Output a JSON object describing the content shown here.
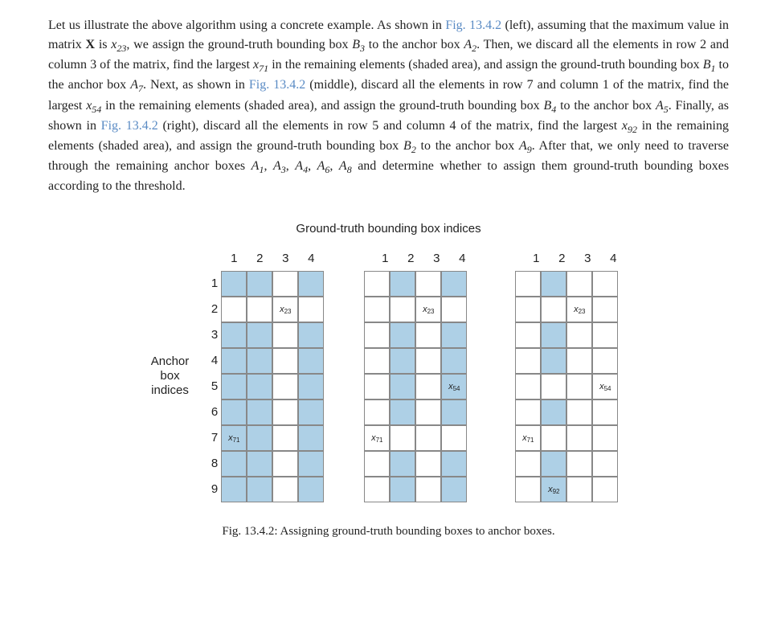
{
  "paragraph": {
    "p1": "Let us illustrate the above algorithm using a concrete example. As shown in ",
    "figref1": "Fig. 13.4.2",
    "p2": " (left), assuming that the maximum value in matrix ",
    "X": "X",
    "p3": " is ",
    "x23": "x",
    "x23sub": "23",
    "p4": ", we assign the ground-truth bounding box ",
    "B3": "B",
    "B3sub": "3",
    "p5": " to the anchor box ",
    "A2": "A",
    "A2sub": "2",
    "p6": ". Then, we discard all the elements in row 2 and column 3 of the matrix, find the largest ",
    "x71": "x",
    "x71sub": "71",
    "p7": " in the remaining elements (shaded area), and assign the ground-truth bounding box ",
    "B1": "B",
    "B1sub": "1",
    "p8": " to the anchor box ",
    "A7": "A",
    "A7sub": "7",
    "p9": ". Next, as shown in ",
    "figref2": "Fig. 13.4.2",
    "p10": " (middle), discard all the elements in row 7 and column 1 of the matrix, find the largest ",
    "x54": "x",
    "x54sub": "54",
    "p11": " in the remaining elements (shaded area), and assign the ground-truth bounding box ",
    "B4": "B",
    "B4sub": "4",
    "p12": " to the anchor box ",
    "A5": "A",
    "A5sub": "5",
    "p13": ". Finally, as shown in ",
    "figref3": "Fig. 13.4.2",
    "p14": " (right), discard all the elements in row 5 and column 4 of the matrix, find the largest ",
    "x92": "x",
    "x92sub": "92",
    "p15": " in the remaining elements (shaded area), and assign the ground-truth bounding box ",
    "B2": "B",
    "B2sub": "2",
    "p16": " to the anchor box ",
    "A9": "A",
    "A9sub": "9",
    "p17": ". After that, we only need to traverse through the remaining anchor boxes ",
    "A1": "A",
    "A1sub": "1",
    "comma1": ", ",
    "A3": "A",
    "A3sub": "3",
    "comma2": ", ",
    "A4": "A",
    "A4sub": "4",
    "comma3": ", ",
    "A6": "A",
    "A6sub": "6",
    "comma4": ", ",
    "A8": "A",
    "A8sub": "8",
    "p18": " and determine whether to assign them ground-truth bounding boxes according to the threshold."
  },
  "figure": {
    "title": "Ground-truth bounding box indices",
    "yaxis": "Anchor\nbox\nindices",
    "cols": [
      "1",
      "2",
      "3",
      "4"
    ],
    "rows": [
      "1",
      "2",
      "3",
      "4",
      "5",
      "6",
      "7",
      "8",
      "9"
    ],
    "matrices": [
      {
        "shaded_cols": [
          0,
          1,
          3
        ],
        "shaded_except_rows": [
          1
        ],
        "labels": [
          {
            "r": 1,
            "c": 2,
            "t": "x",
            "s": "23"
          },
          {
            "r": 6,
            "c": 0,
            "t": "x",
            "s": "71"
          }
        ]
      },
      {
        "shaded_cols": [
          1,
          3
        ],
        "shaded_except_rows": [
          1,
          6
        ],
        "labels": [
          {
            "r": 1,
            "c": 2,
            "t": "x",
            "s": "23"
          },
          {
            "r": 6,
            "c": 0,
            "t": "x",
            "s": "71"
          },
          {
            "r": 4,
            "c": 3,
            "t": "x",
            "s": "54"
          }
        ]
      },
      {
        "shaded_cols": [
          1
        ],
        "shaded_except_rows": [
          1,
          4,
          6
        ],
        "labels": [
          {
            "r": 1,
            "c": 2,
            "t": "x",
            "s": "23"
          },
          {
            "r": 6,
            "c": 0,
            "t": "x",
            "s": "71"
          },
          {
            "r": 4,
            "c": 3,
            "t": "x",
            "s": "54"
          },
          {
            "r": 8,
            "c": 1,
            "t": "x",
            "s": "92"
          }
        ]
      }
    ],
    "caption": "Fig. 13.4.2: Assigning ground-truth bounding boxes to anchor boxes."
  }
}
